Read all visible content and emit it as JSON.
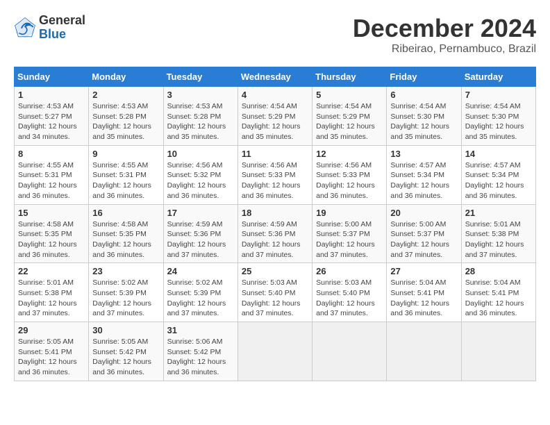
{
  "header": {
    "logo_general": "General",
    "logo_blue": "Blue",
    "title": "December 2024",
    "subtitle": "Ribeirao, Pernambuco, Brazil"
  },
  "columns": [
    "Sunday",
    "Monday",
    "Tuesday",
    "Wednesday",
    "Thursday",
    "Friday",
    "Saturday"
  ],
  "weeks": [
    [
      {
        "day": "1",
        "rise": "4:53 AM",
        "set": "5:27 PM",
        "daylight": "12 hours and 34 minutes."
      },
      {
        "day": "2",
        "rise": "4:53 AM",
        "set": "5:28 PM",
        "daylight": "12 hours and 35 minutes."
      },
      {
        "day": "3",
        "rise": "4:53 AM",
        "set": "5:28 PM",
        "daylight": "12 hours and 35 minutes."
      },
      {
        "day": "4",
        "rise": "4:54 AM",
        "set": "5:29 PM",
        "daylight": "12 hours and 35 minutes."
      },
      {
        "day": "5",
        "rise": "4:54 AM",
        "set": "5:29 PM",
        "daylight": "12 hours and 35 minutes."
      },
      {
        "day": "6",
        "rise": "4:54 AM",
        "set": "5:30 PM",
        "daylight": "12 hours and 35 minutes."
      },
      {
        "day": "7",
        "rise": "4:54 AM",
        "set": "5:30 PM",
        "daylight": "12 hours and 35 minutes."
      }
    ],
    [
      {
        "day": "8",
        "rise": "4:55 AM",
        "set": "5:31 PM",
        "daylight": "12 hours and 36 minutes."
      },
      {
        "day": "9",
        "rise": "4:55 AM",
        "set": "5:31 PM",
        "daylight": "12 hours and 36 minutes."
      },
      {
        "day": "10",
        "rise": "4:56 AM",
        "set": "5:32 PM",
        "daylight": "12 hours and 36 minutes."
      },
      {
        "day": "11",
        "rise": "4:56 AM",
        "set": "5:33 PM",
        "daylight": "12 hours and 36 minutes."
      },
      {
        "day": "12",
        "rise": "4:56 AM",
        "set": "5:33 PM",
        "daylight": "12 hours and 36 minutes."
      },
      {
        "day": "13",
        "rise": "4:57 AM",
        "set": "5:34 PM",
        "daylight": "12 hours and 36 minutes."
      },
      {
        "day": "14",
        "rise": "4:57 AM",
        "set": "5:34 PM",
        "daylight": "12 hours and 36 minutes."
      }
    ],
    [
      {
        "day": "15",
        "rise": "4:58 AM",
        "set": "5:35 PM",
        "daylight": "12 hours and 36 minutes."
      },
      {
        "day": "16",
        "rise": "4:58 AM",
        "set": "5:35 PM",
        "daylight": "12 hours and 36 minutes."
      },
      {
        "day": "17",
        "rise": "4:59 AM",
        "set": "5:36 PM",
        "daylight": "12 hours and 37 minutes."
      },
      {
        "day": "18",
        "rise": "4:59 AM",
        "set": "5:36 PM",
        "daylight": "12 hours and 37 minutes."
      },
      {
        "day": "19",
        "rise": "5:00 AM",
        "set": "5:37 PM",
        "daylight": "12 hours and 37 minutes."
      },
      {
        "day": "20",
        "rise": "5:00 AM",
        "set": "5:37 PM",
        "daylight": "12 hours and 37 minutes."
      },
      {
        "day": "21",
        "rise": "5:01 AM",
        "set": "5:38 PM",
        "daylight": "12 hours and 37 minutes."
      }
    ],
    [
      {
        "day": "22",
        "rise": "5:01 AM",
        "set": "5:38 PM",
        "daylight": "12 hours and 37 minutes."
      },
      {
        "day": "23",
        "rise": "5:02 AM",
        "set": "5:39 PM",
        "daylight": "12 hours and 37 minutes."
      },
      {
        "day": "24",
        "rise": "5:02 AM",
        "set": "5:39 PM",
        "daylight": "12 hours and 37 minutes."
      },
      {
        "day": "25",
        "rise": "5:03 AM",
        "set": "5:40 PM",
        "daylight": "12 hours and 37 minutes."
      },
      {
        "day": "26",
        "rise": "5:03 AM",
        "set": "5:40 PM",
        "daylight": "12 hours and 37 minutes."
      },
      {
        "day": "27",
        "rise": "5:04 AM",
        "set": "5:41 PM",
        "daylight": "12 hours and 36 minutes."
      },
      {
        "day": "28",
        "rise": "5:04 AM",
        "set": "5:41 PM",
        "daylight": "12 hours and 36 minutes."
      }
    ],
    [
      {
        "day": "29",
        "rise": "5:05 AM",
        "set": "5:41 PM",
        "daylight": "12 hours and 36 minutes."
      },
      {
        "day": "30",
        "rise": "5:05 AM",
        "set": "5:42 PM",
        "daylight": "12 hours and 36 minutes."
      },
      {
        "day": "31",
        "rise": "5:06 AM",
        "set": "5:42 PM",
        "daylight": "12 hours and 36 minutes."
      },
      null,
      null,
      null,
      null
    ]
  ],
  "labels": {
    "sunrise": "Sunrise:",
    "sunset": "Sunset:",
    "daylight": "Daylight:"
  }
}
